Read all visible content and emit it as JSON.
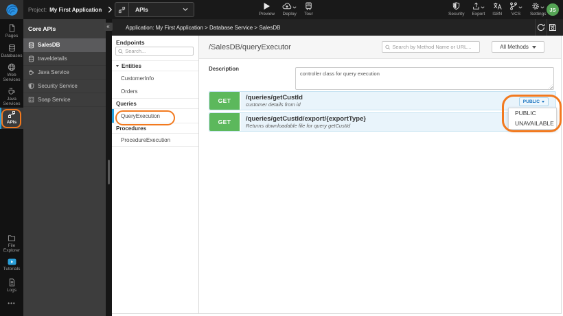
{
  "topbar": {
    "project_label": "Project:",
    "project_name": "My First Application",
    "module": "APIs",
    "preview": "Preview",
    "deploy": "Deploy",
    "tour": "Tour",
    "security": "Security",
    "export": "Export",
    "i18n": "I18N",
    "vcs": "VCS",
    "settings": "Settings",
    "avatar_initials": "JS"
  },
  "rail": {
    "pages": "Pages",
    "databases": "Databases",
    "web_line1": "Web",
    "web_line2": "Services",
    "java_line1": "Java",
    "java_line2": "Services",
    "apis": "APIs",
    "file_line1": "File",
    "file_line2": "Explorer",
    "tutorials": "Tutorials",
    "logs": "Logs",
    "more": "•••"
  },
  "core_apis": {
    "title": "Core APIs",
    "collapse_glyph": "«",
    "items": [
      {
        "label": "SalesDB",
        "icon": "database-icon",
        "selected": true
      },
      {
        "label": "traveldetails",
        "icon": "database-icon",
        "selected": false
      },
      {
        "label": "Java Service",
        "icon": "coffee-icon",
        "selected": false
      },
      {
        "label": "Security Service",
        "icon": "shield-icon",
        "selected": false
      },
      {
        "label": "Soap Service",
        "icon": "soap-icon",
        "selected": false
      }
    ]
  },
  "breadcrumb": {
    "text": "Application: My First Application > Database Service > SalesDB"
  },
  "endpoints": {
    "title": "Endpoints",
    "search_placeholder": "Search...",
    "entities_label": "Entities",
    "entity_items": [
      "CustomerInfo",
      "Orders"
    ],
    "queries_label": "Queries",
    "query_items": [
      "QueryExecution"
    ],
    "procedures_label": "Procedures",
    "procedure_items": [
      "ProcedureExecution"
    ]
  },
  "main": {
    "title": "/SalesDB/queryExecutor",
    "search_placeholder": "Search by Method Name or URL...",
    "methods_filter": "All Methods",
    "description_label": "Description",
    "description_value": "controller class for query execution",
    "operations": [
      {
        "method": "GET",
        "path": "/queries/getCustId",
        "summary": "customer details from id",
        "access": "PUBLIC"
      },
      {
        "method": "GET",
        "path": "/queries/getCustId/export/{exportType}",
        "summary": "Returns downloadable file for query getCustId"
      }
    ],
    "access_menu": [
      "PUBLIC",
      "UNAVAILABLE"
    ]
  },
  "colors": {
    "accent_orange": "#f2791e",
    "get_green": "#5cb85c",
    "row_blue": "#e9f4fb",
    "brand_blue": "#2b93e3",
    "active_blue": "#29a3e0",
    "avatar_green": "#55a455"
  }
}
